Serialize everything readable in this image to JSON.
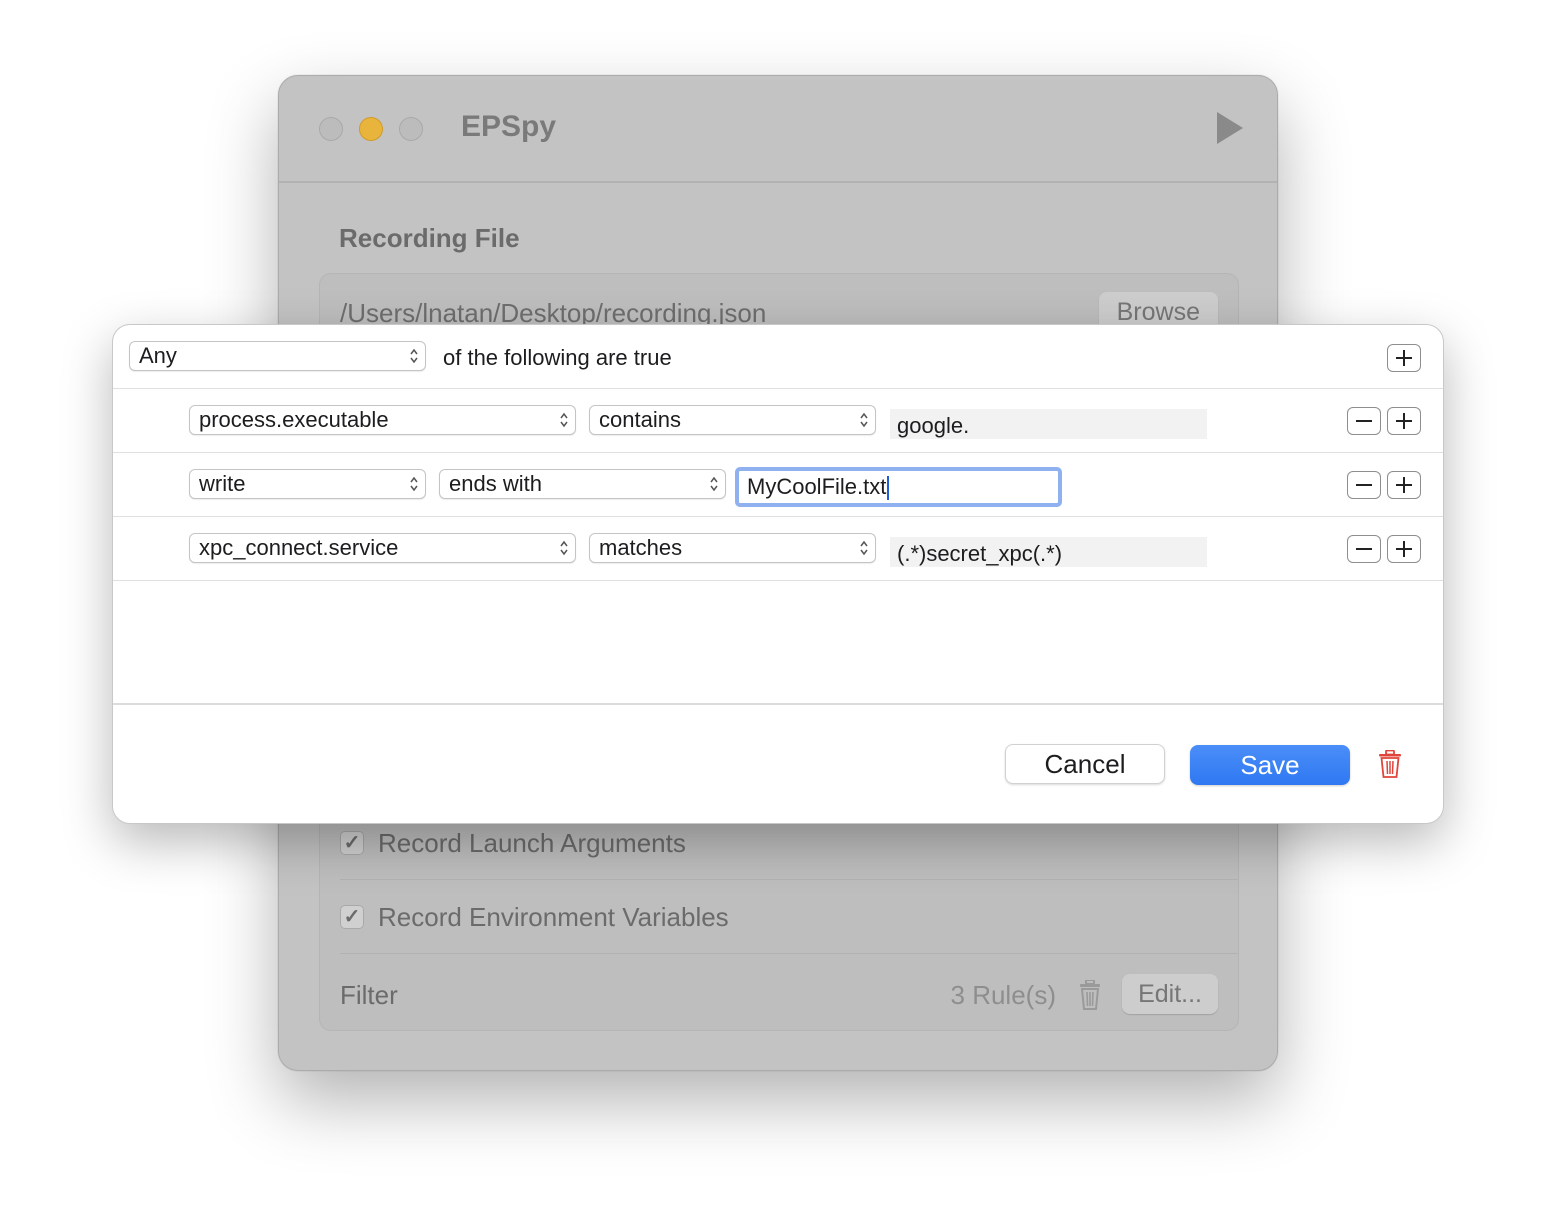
{
  "window": {
    "title": "EPSpy",
    "play_icon": "play-icon"
  },
  "recording": {
    "section_title": "Recording File",
    "path": "/Users/lnatan/Desktop/recording.json",
    "browse_label": "Browse"
  },
  "options": {
    "launch_args_label": "Record Launch Arguments",
    "env_vars_label": "Record Environment Variables",
    "filter_label": "Filter",
    "rules_count": "3 Rule(s)",
    "edit_label": "Edit..."
  },
  "sheet": {
    "match_mode": "Any",
    "header_text": "of the following are true",
    "rules": [
      {
        "key": "process.executable",
        "operator": "contains",
        "value": "google."
      },
      {
        "key": "write",
        "operator": "ends with",
        "value": "MyCoolFile.txt"
      },
      {
        "key": "xpc_connect.service",
        "operator": "matches",
        "value": "(.*)secret_xpc(.*)"
      }
    ],
    "cancel_label": "Cancel",
    "save_label": "Save"
  },
  "colors": {
    "accent": "#2f78f2",
    "trash_red": "#e0443a"
  }
}
